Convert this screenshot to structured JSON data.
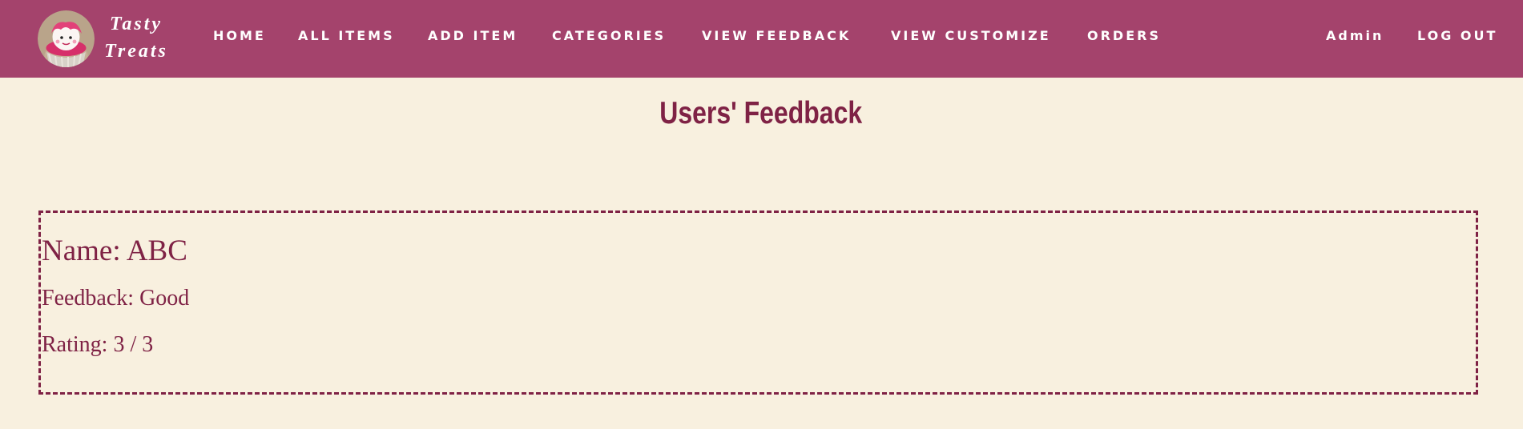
{
  "brand": {
    "line1": "Tasty",
    "line2": "Treats"
  },
  "nav": {
    "items": [
      {
        "label": "HOME"
      },
      {
        "label": "ALL ITEMS"
      },
      {
        "label": "ADD ITEM"
      },
      {
        "label": "CATEGORIES"
      },
      {
        "label": "VIEW FEEDBACK"
      },
      {
        "label": "VIEW CUSTOMIZE"
      },
      {
        "label": "ORDERS"
      }
    ],
    "right": [
      {
        "label": "Admin"
      },
      {
        "label": "LOG OUT"
      }
    ]
  },
  "page": {
    "title": "Users' Feedback"
  },
  "feedback": [
    {
      "name": "Name: ABC",
      "feedback": "Feedback: Good",
      "rating": "Rating: 3 / 3"
    }
  ],
  "colors": {
    "navbar": "#a4436c",
    "background": "#f8f0df",
    "accent": "#7f2245"
  }
}
